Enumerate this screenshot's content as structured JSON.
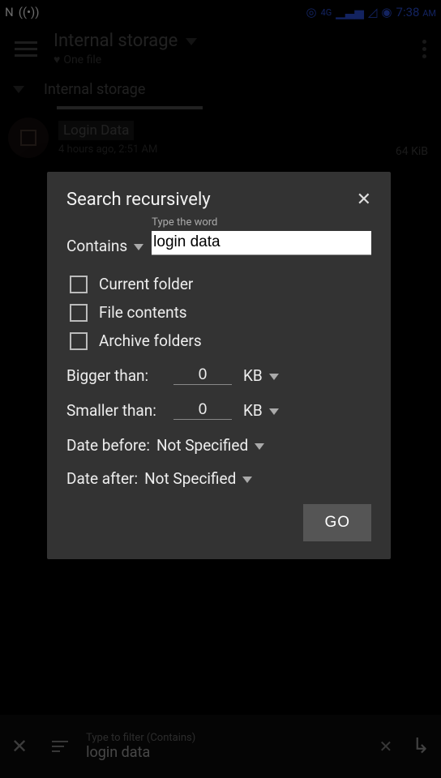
{
  "statusbar": {
    "left_n": "N",
    "time": "7:38",
    "ampm": "AM"
  },
  "appbar": {
    "title": "Internal storage",
    "subtitle": "One file"
  },
  "tabs": {
    "active": "Internal storage"
  },
  "file": {
    "name": "Login Data",
    "meta": "4 hours ago, 2:51 AM",
    "size": "64 KiB"
  },
  "dialog": {
    "title": "Search recursively",
    "mode_label": "Contains",
    "input_hint": "Type the word",
    "input_value": "login data",
    "checks": {
      "current": "Current folder",
      "contents": "File contents",
      "archive": "Archive folders"
    },
    "bigger_label": "Bigger than:",
    "smaller_label": "Smaller than:",
    "bigger_val": "0",
    "smaller_val": "0",
    "unit": "KB",
    "before_label": "Date before:",
    "after_label": "Date after:",
    "not_specified": "Not Specified",
    "go": "GO"
  },
  "bottombar": {
    "hint": "Type to filter (Contains)",
    "value": "login data"
  }
}
